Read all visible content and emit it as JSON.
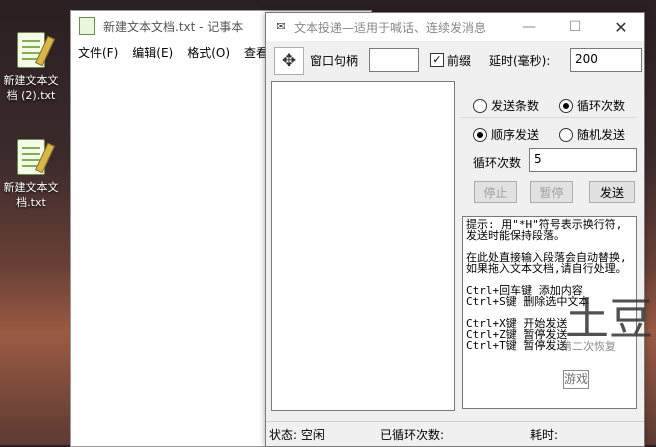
{
  "desktop": {
    "icons": [
      {
        "label": "新建文本文档 (2).txt"
      },
      {
        "label": "新建文本文档.txt"
      }
    ]
  },
  "notepad": {
    "title": "新建文本文档.txt - 记事本",
    "menu": [
      "文件(F)",
      "编辑(E)",
      "格式(O)",
      "查看"
    ]
  },
  "tool": {
    "title": "文本投递—适用于喊话、连续发消息",
    "title_buttons": {
      "minimize": "—",
      "maximize": "☐",
      "close": "✕"
    },
    "handle_label": "窗口句柄",
    "handle_value": "",
    "prefix_label": "前缀",
    "prefix_checked": true,
    "delay_label": "延时(毫秒):",
    "delay_value": "200",
    "radio_mode_1": "发送条数",
    "radio_mode_2": "循环次数",
    "radio_mode_selected": "循环次数",
    "radio_order_1": "顺序发送",
    "radio_order_2": "随机发送",
    "radio_order_selected": "顺序发送",
    "loop_label": "循环次数",
    "loop_value": "5",
    "buttons": {
      "stop": "停止",
      "pause": "暂停",
      "send": "发送"
    },
    "hint_lines": [
      "提示: 用\"*H\"符号表示换行符,",
      "发送时能保持段落。",
      "",
      "在此处直接输入段落会自动替换,",
      "如果拖入文本文档,请自行处理。",
      "",
      "Ctrl+回车键 添加内容",
      "Ctrl+S键 删除选中文本",
      "",
      "Ctrl+X键 开始发送",
      "Ctrl+Z键 暂停发送",
      "Ctrl+T键 暂停发送"
    ],
    "status": {
      "state": "状态: 空闲",
      "loops": "已循环次数:",
      "elapsed": "耗时:"
    }
  },
  "watermark": {
    "big": "土豆",
    "sub": "第二次恢复",
    "stamp": "游戏"
  }
}
